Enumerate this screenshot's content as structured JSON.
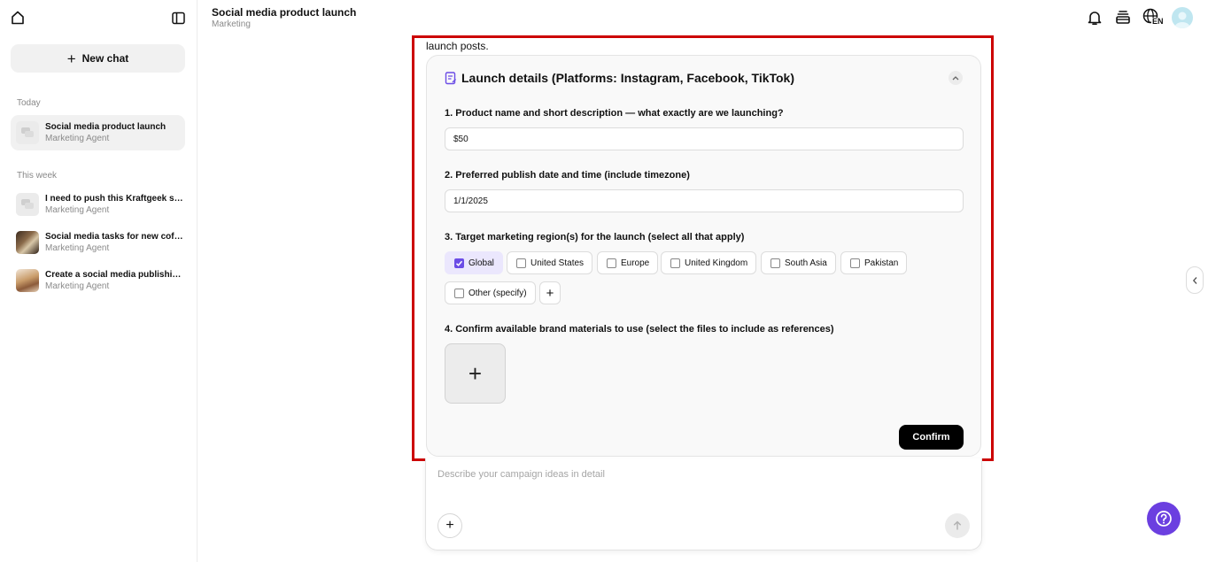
{
  "sidebar": {
    "new_chat_label": "New chat",
    "groups": [
      {
        "label": "Today",
        "items": [
          {
            "title": "Social media product launch",
            "subtitle": "Marketing Agent"
          }
        ]
      },
      {
        "label": "This week",
        "items": [
          {
            "title": "I need to push this Kraftgeek se...",
            "subtitle": "Marketing Agent"
          },
          {
            "title": "Social media tasks for new coff...",
            "subtitle": "Marketing Agent"
          },
          {
            "title": "Create a social media publishin...",
            "subtitle": "Marketing Agent"
          }
        ]
      }
    ]
  },
  "header": {
    "title": "Social media product launch",
    "subtitle": "Marketing",
    "language_badge": "EN"
  },
  "main": {
    "intro_text": "launch posts.",
    "card": {
      "title": "Launch details (Platforms: Instagram, Facebook, TikTok)",
      "questions": [
        {
          "label": "1. Product name and short description — what exactly are we launching?",
          "value": "$50"
        },
        {
          "label": "2. Preferred publish date and time (include timezone)",
          "value": "1/1/2025"
        },
        {
          "label": "3. Target marketing region(s) for the launch (select all that apply)"
        },
        {
          "label": "4. Confirm available brand materials to use (select the files to include as references)"
        }
      ],
      "regions": [
        {
          "label": "Global",
          "checked": true
        },
        {
          "label": "United States",
          "checked": false
        },
        {
          "label": "Europe",
          "checked": false
        },
        {
          "label": "United Kingdom",
          "checked": false
        },
        {
          "label": "South Asia",
          "checked": false
        },
        {
          "label": "Pakistan",
          "checked": false
        },
        {
          "label": "Other (specify)",
          "checked": false
        }
      ],
      "add_region_label": "+",
      "upload_label": "+",
      "confirm_label": "Confirm"
    },
    "composer": {
      "placeholder": "Describe your campaign ideas in detail",
      "add_label": "+"
    }
  },
  "colors": {
    "accent": "#6b4ce6",
    "help_button": "#6b3fe0",
    "highlight_border": "#cc0000",
    "confirm_bg": "#000000"
  },
  "icons": [
    "home-icon",
    "sidebar-toggle-icon",
    "chat-bubble-icon",
    "bell-icon",
    "inbox-stack-icon",
    "globe-icon",
    "clipboard-edit-icon",
    "chevron-up-icon",
    "check-icon",
    "arrow-up-icon",
    "chevron-left-icon",
    "help-icon"
  ]
}
